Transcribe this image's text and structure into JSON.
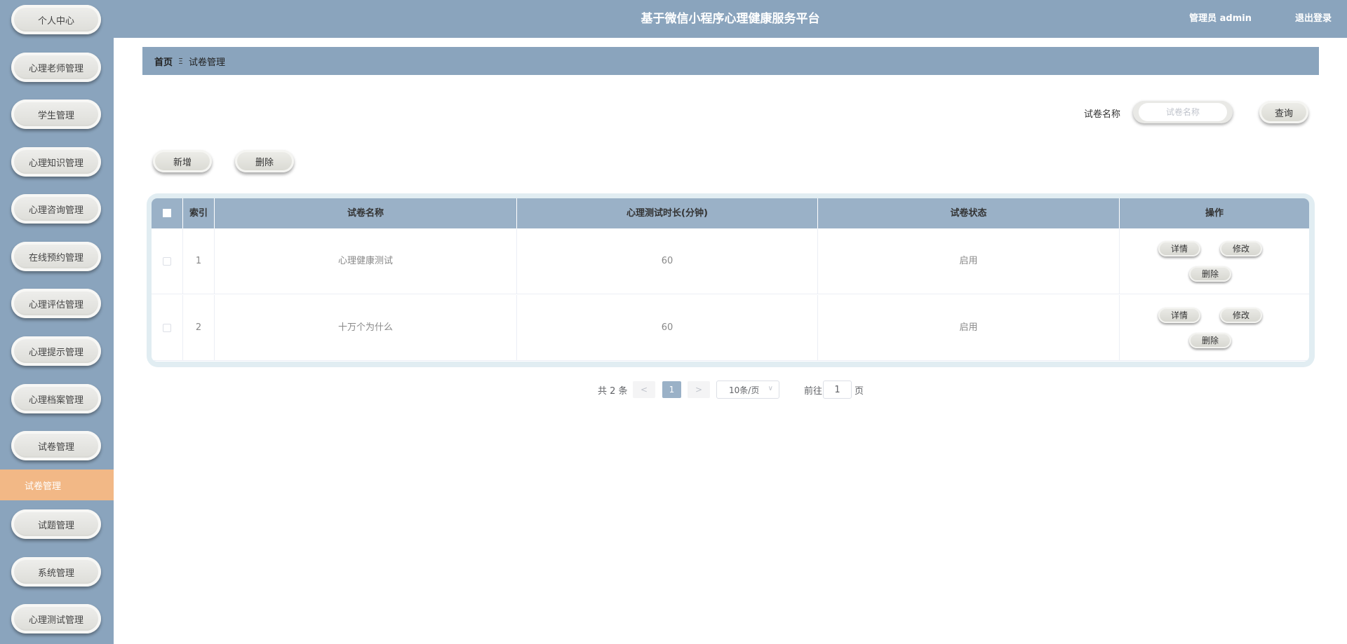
{
  "app": {
    "title": "基于微信小程序心理健康服务平台",
    "user_label": "管理员 admin",
    "logout_label": "退出登录"
  },
  "sidebar": {
    "items": [
      {
        "label": "个人中心"
      },
      {
        "label": "心理老师管理"
      },
      {
        "label": "学生管理"
      },
      {
        "label": "心理知识管理"
      },
      {
        "label": "心理咨询管理"
      },
      {
        "label": "在线预约管理"
      },
      {
        "label": "心理评估管理"
      },
      {
        "label": "心理提示管理"
      },
      {
        "label": "心理档案管理"
      },
      {
        "label": "试卷管理"
      },
      {
        "label": "试题管理"
      },
      {
        "label": "系统管理"
      },
      {
        "label": "心理测试管理"
      }
    ],
    "active_label": "试卷管理"
  },
  "breadcrumb": {
    "home": "首页",
    "separator": "Ξ",
    "current": "试卷管理"
  },
  "search": {
    "label": "试卷名称",
    "placeholder": "试卷名称",
    "value": "",
    "button": "查询"
  },
  "toolbar": {
    "add_label": "新增",
    "delete_label": "删除"
  },
  "table": {
    "columns": [
      "索引",
      "试卷名称",
      "心理测试时长(分钟)",
      "试卷状态",
      "操作"
    ],
    "rows": [
      {
        "index": "1",
        "name": "心理健康测试",
        "duration": "60",
        "status": "启用"
      },
      {
        "index": "2",
        "name": "十万个为什么",
        "duration": "60",
        "status": "启用"
      }
    ],
    "actions": {
      "detail": "详情",
      "edit": "修改",
      "delete": "删除"
    }
  },
  "pagination": {
    "total_text": "共 2 条",
    "prev": "<",
    "current_page": "1",
    "next": ">",
    "page_size": "10条/页",
    "goto_prefix": "前往",
    "goto_value": "1",
    "goto_suffix": "页"
  },
  "colors": {
    "header_bg": "#8aa4bd",
    "table_head_bg": "#9ab1c7",
    "active_item_bg": "#f2b886"
  }
}
